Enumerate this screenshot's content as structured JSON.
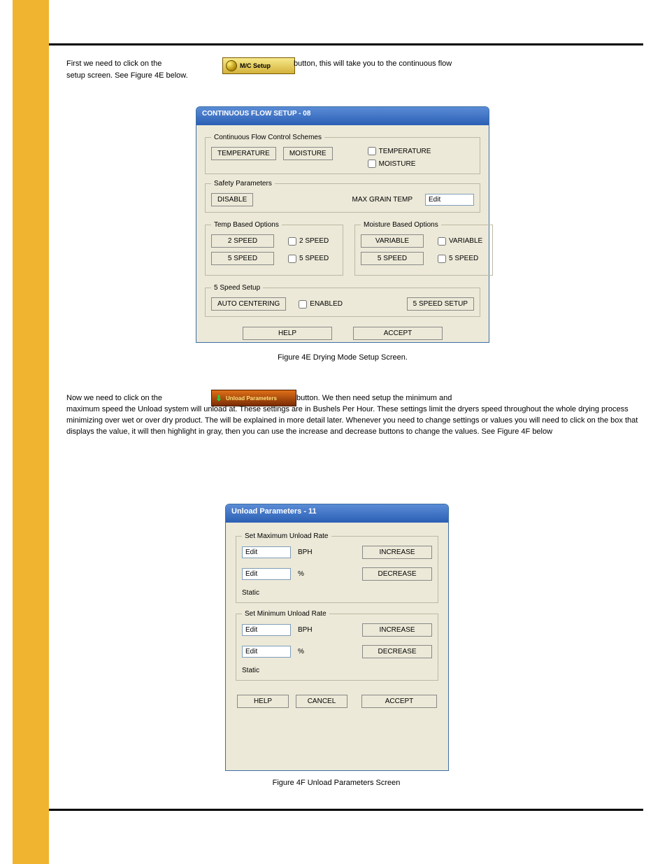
{
  "intro": {
    "part1": "First we need to click on the",
    "mc_label": "M/C Setup",
    "part2": "button, this will take you to the continuous flow",
    "part3": "setup screen. See Figure 4E below."
  },
  "dlg1": {
    "title": "CONTINUOUS FLOW SETUP - 08",
    "cfcs": {
      "legend": "Continuous Flow Control Schemes",
      "btn_temp": "TEMPERATURE",
      "btn_moist": "MOISTURE",
      "chk_temp": "TEMPERATURE",
      "chk_moist": "MOISTURE"
    },
    "safety": {
      "legend": "Safety Parameters",
      "btn_disable": "DISABLE",
      "max_label": "MAX GRAIN TEMP",
      "edit_value": "Edit"
    },
    "temp_opts": {
      "legend": "Temp Based Options",
      "btn_2s": "2 SPEED",
      "chk_2s": "2 SPEED",
      "btn_5s": "5 SPEED",
      "chk_5s": "5 SPEED"
    },
    "moist_opts": {
      "legend": "Moisture Based Options",
      "btn_var": "VARIABLE",
      "chk_var": "VARIABLE",
      "btn_5s": "5 SPEED",
      "chk_5s": "5 SPEED"
    },
    "fss": {
      "legend": "5 Speed Setup",
      "btn_auto": "AUTO CENTERING",
      "chk_enabled": "ENABLED",
      "btn_setup": "5 SPEED SETUP"
    },
    "footer": {
      "help": "HELP",
      "accept": "ACCEPT"
    }
  },
  "fig1_caption": "Figure 4E Drying Mode Setup Screen.",
  "para2": {
    "a": "Now we need to click on the",
    "btn_label": "Unload Parameters",
    "b": "button. We then need setup the minimum and",
    "c": "maximum speed the Unload system will unload at. These settings are in Bushels Per Hour. These settings limit the dryers speed throughout the whole drying process minimizing over wet or over dry product. The will be explained in more detail later. Whenever you need to change settings or values you will need to click on the box that displays the value, it will then highlight in gray, then you can use the increase and decrease buttons to change the values. See Figure 4F below"
  },
  "dlg2": {
    "title": "Unload Parameters - 11",
    "max": {
      "legend": "Set Maximum Unload Rate",
      "edit1": "Edit",
      "unit1": "BPH",
      "inc": "INCREASE",
      "edit2": "Edit",
      "unit2": "%",
      "dec": "DECREASE",
      "static": "Static"
    },
    "min": {
      "legend": "Set Minimum Unload Rate",
      "edit1": "Edit",
      "unit1": "BPH",
      "inc": "INCREASE",
      "edit2": "Edit",
      "unit2": "%",
      "dec": "DECREASE",
      "static": "Static"
    },
    "footer": {
      "help": "HELP",
      "cancel": "CANCEL",
      "accept": "ACCEPT"
    }
  },
  "fig2_caption": "Figure 4F Unload Parameters Screen"
}
